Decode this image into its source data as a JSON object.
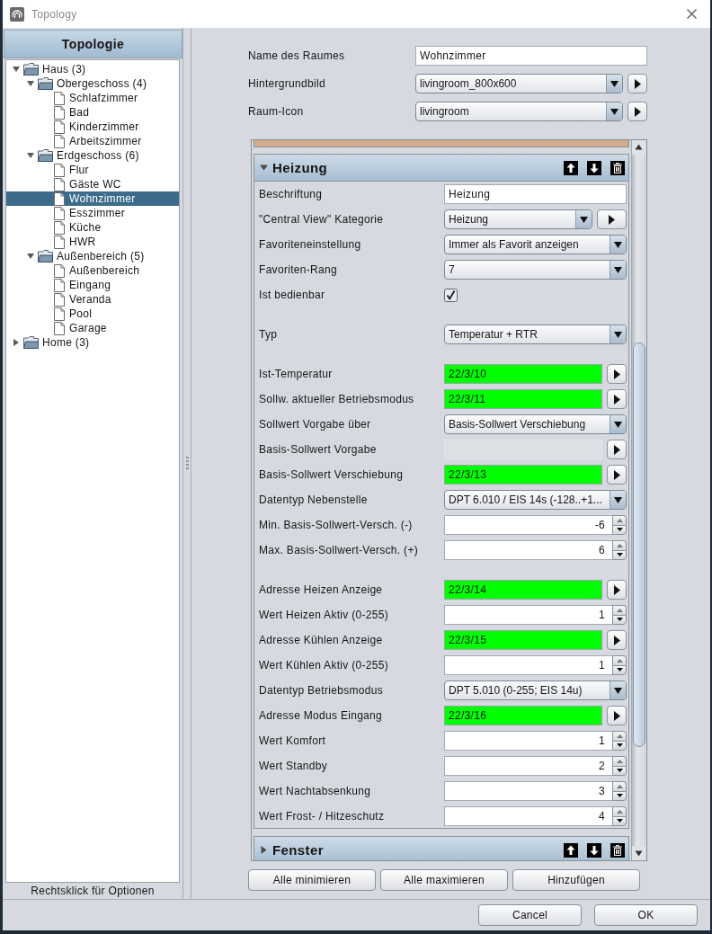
{
  "window": {
    "title": "Topology"
  },
  "sidebar": {
    "title": "Topologie",
    "tree": [
      {
        "kind": "folder",
        "label": "Haus (3)",
        "expanded": true,
        "selected": false,
        "children": [
          {
            "kind": "folder",
            "label": "Obergeschoss (4)",
            "expanded": true,
            "selected": false,
            "children": [
              {
                "kind": "room",
                "label": "Schlafzimmer",
                "selected": false
              },
              {
                "kind": "room",
                "label": "Bad",
                "selected": false
              },
              {
                "kind": "room",
                "label": "Kinderzimmer",
                "selected": false
              },
              {
                "kind": "room",
                "label": "Arbeitszimmer",
                "selected": false
              }
            ]
          },
          {
            "kind": "folder",
            "label": "Erdgeschoss (6)",
            "expanded": true,
            "selected": false,
            "children": [
              {
                "kind": "room",
                "label": "Flur",
                "selected": false
              },
              {
                "kind": "room",
                "label": "Gäste WC",
                "selected": false
              },
              {
                "kind": "room",
                "label": "Wohnzimmer",
                "selected": true
              },
              {
                "kind": "room",
                "label": "Esszimmer",
                "selected": false
              },
              {
                "kind": "room",
                "label": "Küche",
                "selected": false
              },
              {
                "kind": "room",
                "label": "HWR",
                "selected": false
              }
            ]
          },
          {
            "kind": "folder",
            "label": "Außenbereich (5)",
            "expanded": true,
            "selected": false,
            "children": [
              {
                "kind": "room",
                "label": "Außenbereich",
                "selected": false
              },
              {
                "kind": "room",
                "label": "Eingang",
                "selected": false
              },
              {
                "kind": "room",
                "label": "Veranda",
                "selected": false
              },
              {
                "kind": "room",
                "label": "Pool",
                "selected": false
              },
              {
                "kind": "room",
                "label": "Garage",
                "selected": false
              }
            ]
          }
        ]
      },
      {
        "kind": "folder",
        "label": "Home (3)",
        "expanded": false,
        "selected": false
      }
    ],
    "hint": "Rechtsklick für Optionen"
  },
  "room": [
    {
      "kind": "text",
      "label": "Name des Raumes",
      "value": "Wohnzimmer"
    },
    {
      "kind": "combo_button",
      "label": "Hintergrundbild",
      "value": "livingroom_800x600"
    },
    {
      "kind": "combo_button",
      "label": "Raum-Icon",
      "value": "livingroom"
    }
  ],
  "sections": [
    {
      "title": "Heizung",
      "expanded": true,
      "groups": [
        {
          "fields": [
            {
              "kind": "text",
              "label": "Beschriftung",
              "value": "Heizung"
            },
            {
              "kind": "combo_button",
              "label": "\"Central View\" Kategorie",
              "value": "Heizung"
            },
            {
              "kind": "combo",
              "label": "Favoriteneinstellung",
              "value": "Immer als Favorit anzeigen"
            },
            {
              "kind": "combo",
              "label": "Favoriten-Rang",
              "value": "7"
            },
            {
              "kind": "checkbox",
              "label": "Ist bedienbar",
              "checked": true
            }
          ]
        },
        {
          "fields": [
            {
              "kind": "combo",
              "label": "Typ",
              "value": "Temperatur + RTR"
            }
          ]
        },
        {
          "fields": [
            {
              "kind": "address",
              "label": "Ist-Temperatur",
              "value": "22/3/10",
              "disabled": false
            },
            {
              "kind": "address",
              "label": "Sollw. aktueller Betriebsmodus",
              "value": "22/3/11",
              "disabled": false
            },
            {
              "kind": "combo",
              "label": "Sollwert Vorgabe über",
              "value": "Basis-Sollwert Verschiebung"
            },
            {
              "kind": "address",
              "label": "Basis-Sollwert Vorgabe",
              "disabled": true
            },
            {
              "kind": "address",
              "label": "Basis-Sollwert Verschiebung",
              "value": "22/3/13",
              "disabled": false
            },
            {
              "kind": "combo",
              "label": "Datentyp Nebenstelle",
              "value": "DPT 6.010 / EIS 14s (-128..+1..."
            },
            {
              "kind": "spinner",
              "label": "Min. Basis-Sollwert-Versch. (-)",
              "value": "-6"
            },
            {
              "kind": "spinner",
              "label": "Max. Basis-Sollwert-Versch. (+)",
              "value": "6"
            }
          ]
        },
        {
          "fields": [
            {
              "kind": "address",
              "label": "Adresse Heizen Anzeige",
              "value": "22/3/14",
              "disabled": false
            },
            {
              "kind": "spinner",
              "label": "Wert Heizen Aktiv (0-255)",
              "value": "1"
            },
            {
              "kind": "address",
              "label": "Adresse Kühlen Anzeige",
              "value": "22/3/15",
              "disabled": false
            },
            {
              "kind": "spinner",
              "label": "Wert Kühlen Aktiv (0-255)",
              "value": "1"
            },
            {
              "kind": "combo",
              "label": "Datentyp Betriebsmodus",
              "value": "DPT 5.010 (0-255; EIS 14u)"
            },
            {
              "kind": "address",
              "label": "Adresse Modus Eingang",
              "value": "22/3/16",
              "disabled": false
            },
            {
              "kind": "spinner",
              "label": "Wert Komfort",
              "value": "1"
            },
            {
              "kind": "spinner",
              "label": "Wert Standby",
              "value": "2"
            },
            {
              "kind": "spinner",
              "label": "Wert Nachtabsenkung",
              "value": "3"
            },
            {
              "kind": "spinner",
              "label": "Wert Frost- / Hitzeschutz",
              "value": "4"
            }
          ]
        }
      ]
    },
    {
      "title": "Fenster",
      "expanded": false
    }
  ],
  "actions": [
    "Alle minimieren",
    "Alle maximieren",
    "Hinzufügen"
  ],
  "dialog_buttons": [
    "Cancel",
    "OK"
  ]
}
